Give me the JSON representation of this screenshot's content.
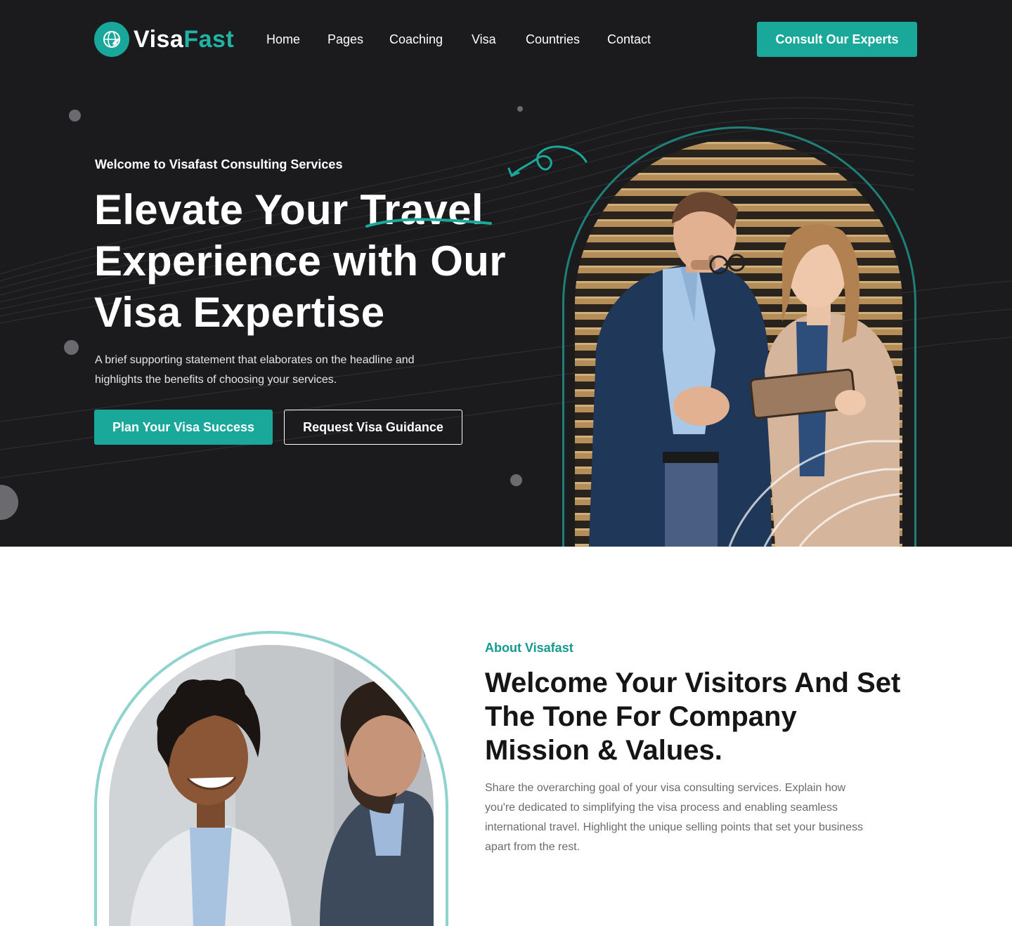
{
  "brand": {
    "name_part1": "Visa",
    "name_part2": "Fast"
  },
  "nav": {
    "items": [
      "Home",
      "Pages",
      "Coaching",
      "Visa",
      "Countries",
      "Contact"
    ],
    "cta_label": "Consult Our Experts"
  },
  "hero": {
    "eyebrow": "Welcome to Visafast Consulting Services",
    "headline_part1": "Elevate Your ",
    "headline_highlight": "Travel",
    "headline_part2": "Experience with Our Visa Expertise",
    "description": "A brief supporting statement that elaborates on the headline and highlights the benefits of choosing your services.",
    "primary_button": "Plan Your Visa Success",
    "secondary_button": "Request Visa Guidance"
  },
  "about": {
    "eyebrow": "About Visafast",
    "title": "Welcome Your Visitors And Set The Tone For Company Mission & Values.",
    "text": "Share the overarching goal of your visa consulting services. Explain how you're dedicated to simplifying the visa process and enabling seamless international travel. Highlight the unique selling points that set your business apart from the rest."
  },
  "colors": {
    "accent": "#1aa89b",
    "hero_bg": "#1b1b1d",
    "about_outline": "#8fd3cf",
    "text_dark": "#151515"
  },
  "icons": {
    "logo": "globe-plane-icon",
    "decor_arrow": "curly-arrow-icon"
  }
}
